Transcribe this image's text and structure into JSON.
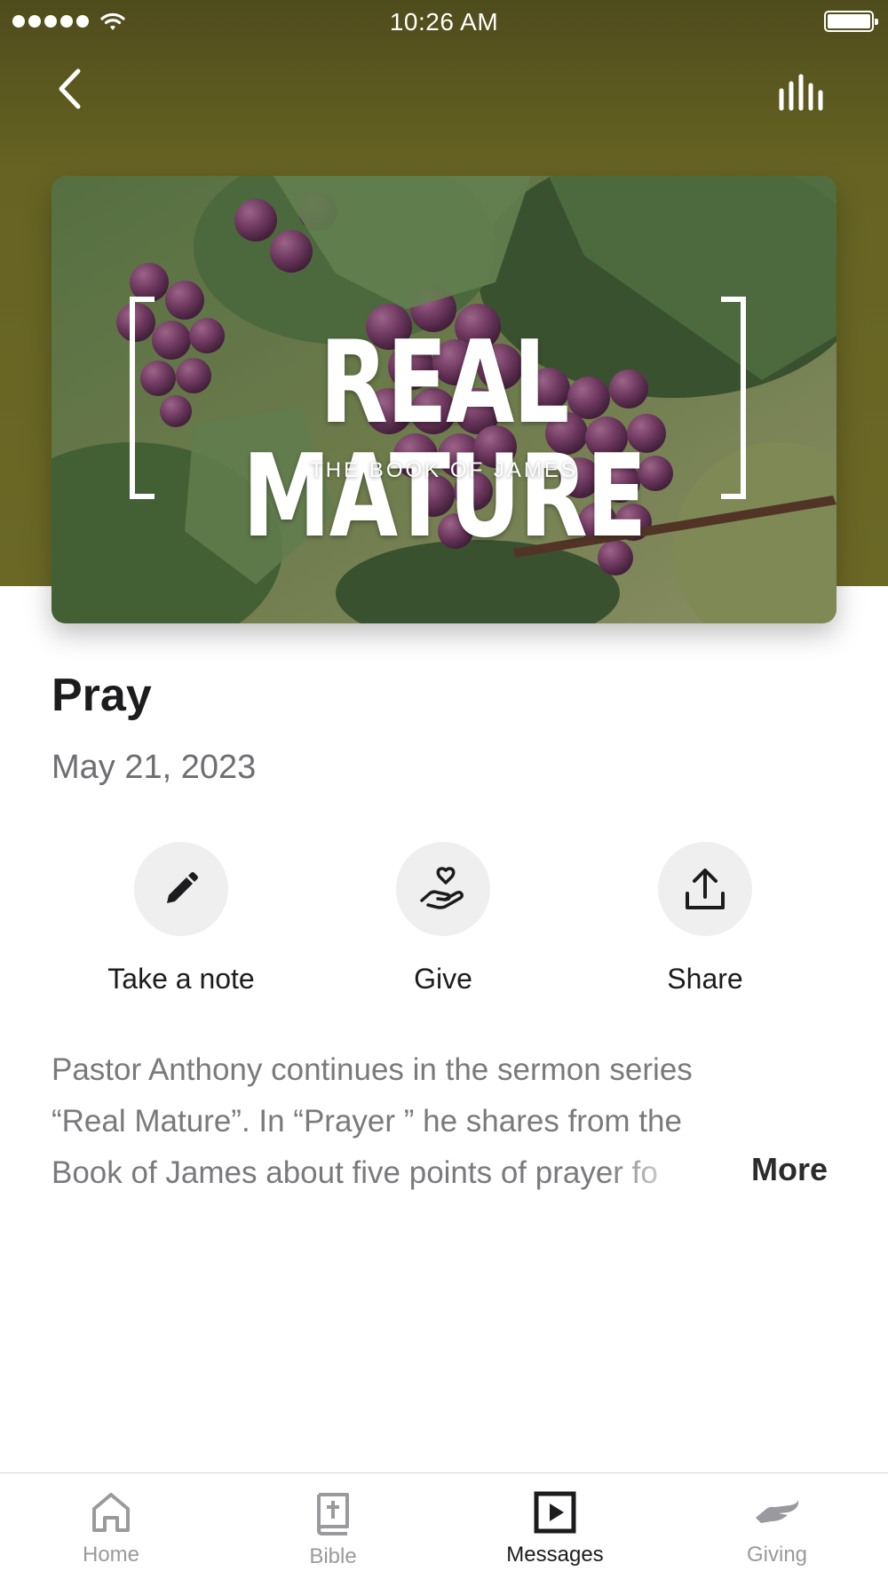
{
  "status_bar": {
    "time": "10:26 AM"
  },
  "artwork": {
    "title": "REAL MATURE",
    "subtitle": "THE BOOK OF JAMES"
  },
  "message": {
    "title": "Pray",
    "date": "May 21, 2023",
    "description_lines": [
      "Pastor Anthony continues in the sermon series",
      "“Real Mature”. In “Prayer ” he shares from the",
      "Book of James about five points of prayer fo"
    ],
    "more_label": "More"
  },
  "actions": [
    {
      "label": "Take a note",
      "icon": "pencil-icon"
    },
    {
      "label": "Give",
      "icon": "hand-heart-icon"
    },
    {
      "label": "Share",
      "icon": "share-icon"
    }
  ],
  "tabs": [
    {
      "label": "Home",
      "icon": "home-icon",
      "active": false
    },
    {
      "label": "Bible",
      "icon": "bible-icon",
      "active": false
    },
    {
      "label": "Messages",
      "icon": "play-square-icon",
      "active": true
    },
    {
      "label": "Giving",
      "icon": "giving-hand-icon",
      "active": false
    }
  ],
  "colors": {
    "header": "#676423",
    "active_tab": "#1c1c1e",
    "inactive_tab": "#9a9a9e"
  }
}
